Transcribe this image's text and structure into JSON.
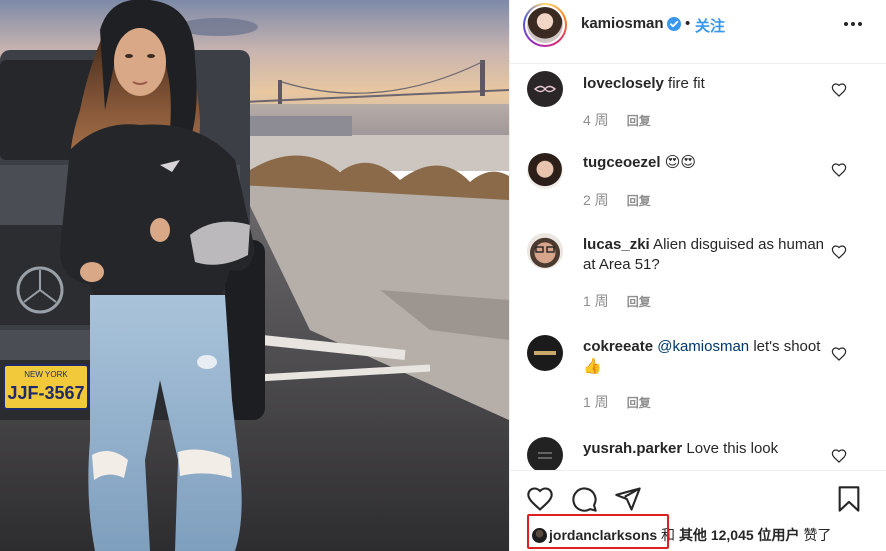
{
  "post": {
    "username": "kamiosman",
    "separator": "•",
    "follow_label": "关注"
  },
  "photo": {
    "license_plate_state": "NEW YORK",
    "license_plate_text": "JJF-3567"
  },
  "comments": [
    {
      "username": "loveclosely",
      "text": " fire fit",
      "time": "4 周",
      "reply": "回复"
    },
    {
      "username": "tugceoezel",
      "text": " 😍😍",
      "time": "2 周",
      "reply": "回复"
    },
    {
      "username": "lucas_zki",
      "text": " Alien disguised as human at Area 51?",
      "time": "1 周",
      "reply": "回复"
    },
    {
      "username": "cokreeate",
      "mention": "@kamiosman",
      "text": " let's shoot 👍",
      "time": "1 周",
      "reply": "回复"
    },
    {
      "username": "yusrah.parker",
      "text": " Love this look"
    }
  ],
  "likes": {
    "liker": "jordanclarksons",
    "and": "和",
    "others_label": "其他",
    "count": "12,045",
    "users_label": "位用户",
    "liked": "赞了"
  },
  "colors": {
    "accent_blue": "#3897f0",
    "highlight_red": "#e02020"
  },
  "icons": [
    "verified-badge-icon",
    "more-options-icon",
    "heart-icon",
    "comment-icon",
    "share-icon",
    "bookmark-icon",
    "heart-outline-small-icon"
  ]
}
